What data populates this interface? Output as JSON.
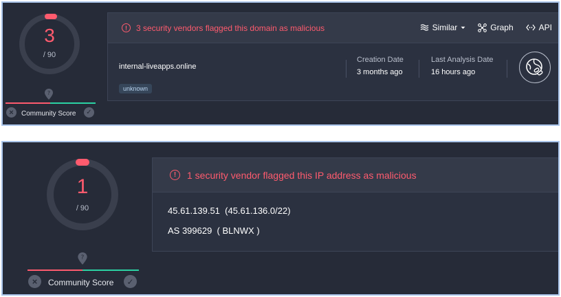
{
  "domain_report": {
    "score": {
      "detections": "3",
      "total": "/ 90",
      "fraction": 0.033
    },
    "community": {
      "label": "Community Score",
      "pin_symbol": "?",
      "dislike_symbol": "×",
      "like_symbol": "✓"
    },
    "alert": {
      "icon": "!",
      "text": "3 security vendors flagged this domain as malicious"
    },
    "actions": {
      "similar": "Similar",
      "graph": "Graph",
      "api": "API"
    },
    "domain": "internal-liveapps.online",
    "tag": "unknown",
    "creation_date_label": "Creation Date",
    "creation_date_value": "3 months ago",
    "last_analysis_label": "Last Analysis Date",
    "last_analysis_value": "16 hours ago",
    "badge_icon": "web-links-icon"
  },
  "ip_report": {
    "score": {
      "detections": "1",
      "total": "/ 90",
      "fraction": 0.011
    },
    "community": {
      "label": "Community Score",
      "pin_symbol": "?",
      "dislike_symbol": "×",
      "like_symbol": "✓"
    },
    "alert": {
      "icon": "!",
      "text": "1 security vendor flagged this IP address as malicious"
    },
    "ip_line": "45.61.139.51  (45.61.136.0/22)",
    "as_line": "AS 399629  ( BLNWX )"
  },
  "colors": {
    "accent": "#ff5b6e",
    "ring": "#3a3f4d",
    "green": "#2bd3a4",
    "panel": "#262b38"
  }
}
